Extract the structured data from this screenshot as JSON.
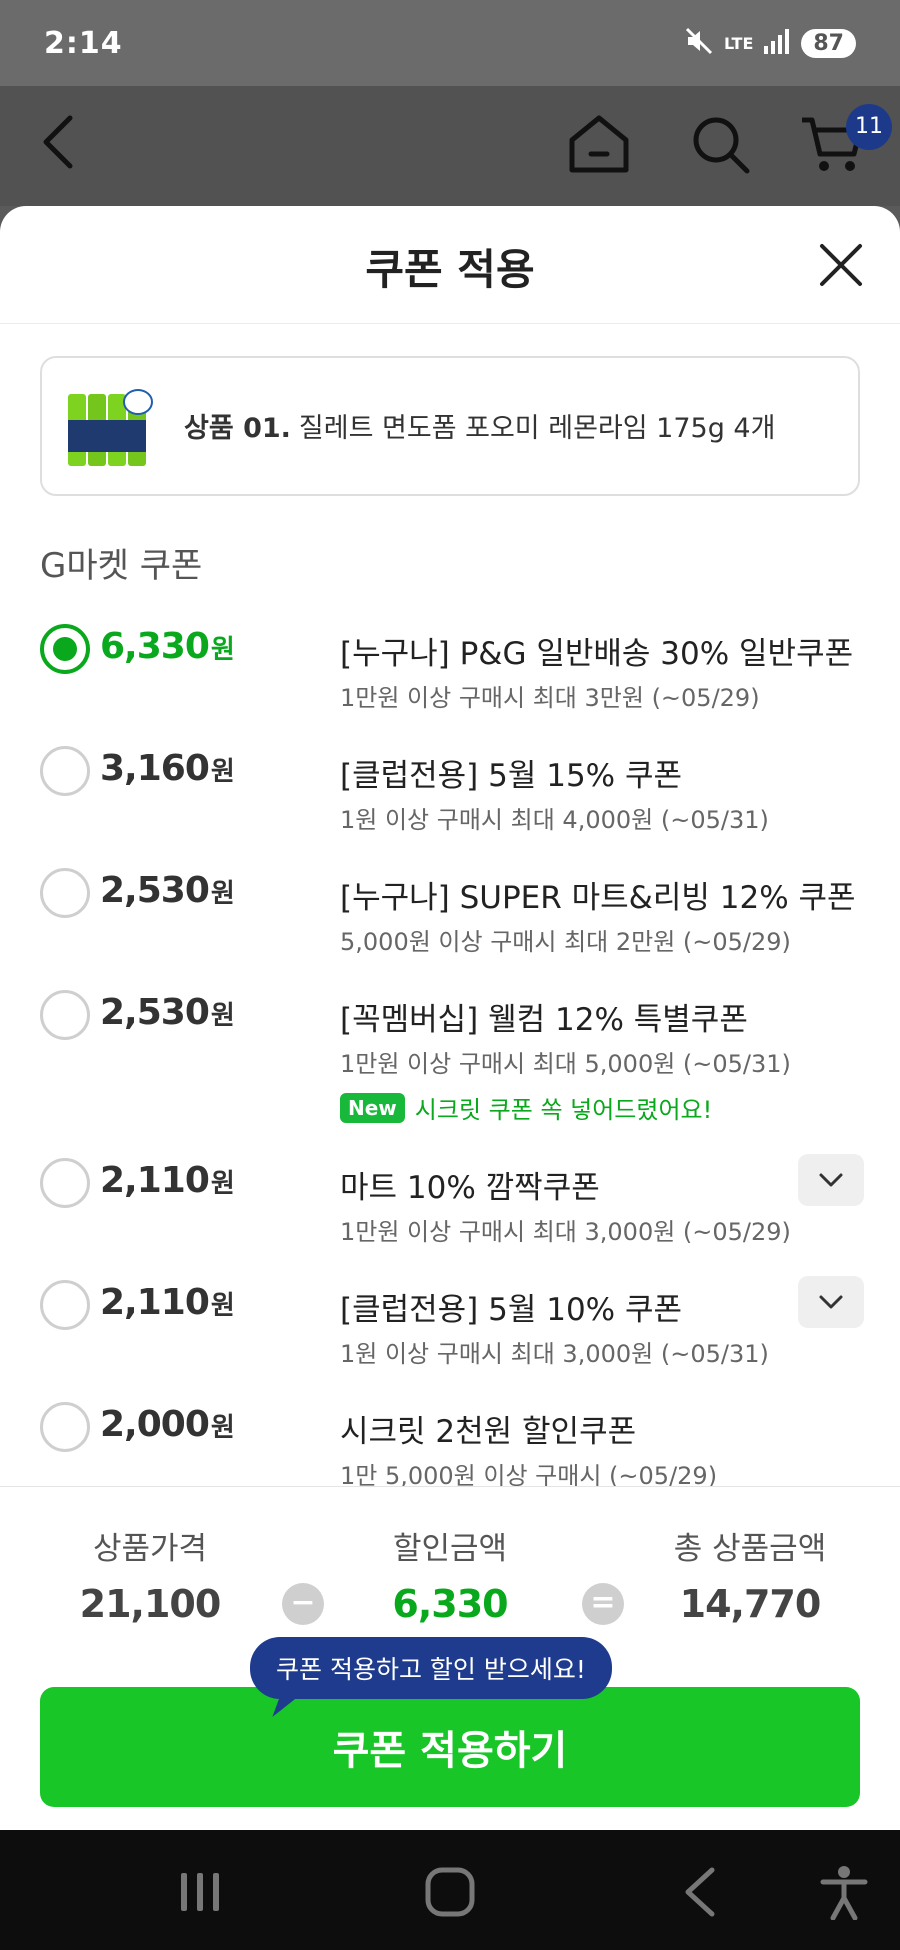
{
  "status_bar": {
    "time": "2:14",
    "network": "LTE",
    "battery": "87"
  },
  "top_bar": {
    "cart_count": "11"
  },
  "sheet": {
    "title": "쿠폰 적용"
  },
  "product": {
    "prefix": "상품 01.",
    "name": "질레트 면도폼 포오미 레몬라임 175g 4개"
  },
  "section_title": "G마켓 쿠폰",
  "unit": "원",
  "coupons": [
    {
      "amount": "6,330",
      "title": "[누구나] P&G 일반배송 30% 일반쿠폰",
      "condition": "1만원 이상 구매시 최대 3만원 (~05/29)",
      "selected": true
    },
    {
      "amount": "3,160",
      "title": "[클럽전용] 5월 15% 쿠폰",
      "condition": "1원 이상 구매시 최대 4,000원 (~05/31)"
    },
    {
      "amount": "2,530",
      "title": "[누구나] SUPER 마트&리빙 12% 쿠폰",
      "condition": "5,000원 이상 구매시 최대 2만원 (~05/29)"
    },
    {
      "amount": "2,530",
      "title": "[꼭멤버십] 웰컴 12% 특별쿠폰",
      "condition": "1만원 이상 구매시 최대 5,000원 (~05/31)",
      "new_tag": "New",
      "new_text": "시크릿 쿠폰 쏙 넣어드렸어요!"
    },
    {
      "amount": "2,110",
      "title": "마트 10% 깜짝쿠폰",
      "condition": "1만원 이상 구매시 최대 3,000원 (~05/29)",
      "expandable": true
    },
    {
      "amount": "2,110",
      "title": "[클럽전용] 5월 10% 쿠폰",
      "condition": "1원 이상 구매시 최대 3,000원 (~05/31)",
      "expandable": true
    },
    {
      "amount": "2,000",
      "title": "시크릿 2천원 할인쿠폰",
      "condition": "1만 5,000원 이상 구매시 (~05/29)"
    }
  ],
  "summary": {
    "price_label": "상품가격",
    "price": "21,100",
    "minus": "−",
    "discount_label": "할인금액",
    "discount": "6,330",
    "equals": "=",
    "total_label": "총 상품금액",
    "total": "14,770"
  },
  "tooltip": "쿠폰 적용하고 할인 받으세요!",
  "apply_button": "쿠폰 적용하기",
  "colors": {
    "accent_green": "#0aa81d",
    "button_green": "#18c627",
    "tooltip_navy": "#1f3b8e"
  }
}
